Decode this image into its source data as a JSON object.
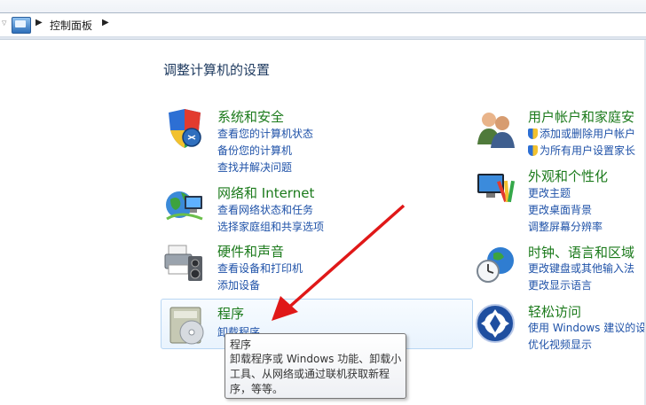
{
  "address_bar": {
    "crumb": "控制面板"
  },
  "heading": "调整计算机的设置",
  "categories_left": [
    {
      "title": "系统和安全",
      "icon": "shield-security-icon",
      "links": [
        "查看您的计算机状态",
        "备份您的计算机",
        "查找并解决问题"
      ]
    },
    {
      "title": "网络和 Internet",
      "icon": "network-globe-icon",
      "links": [
        "查看网络状态和任务",
        "选择家庭组和共享选项"
      ]
    },
    {
      "title": "硬件和声音",
      "icon": "printer-speaker-icon",
      "links": [
        "查看设备和打印机",
        "添加设备"
      ]
    },
    {
      "title": "程序",
      "icon": "programs-disc-icon",
      "links": [
        "卸载程序"
      ]
    }
  ],
  "categories_right": [
    {
      "title": "用户帐户和家庭安",
      "icon": "users-icon",
      "links": [
        "添加或删除用户帐户",
        "为所有用户设置家长"
      ]
    },
    {
      "title": "外观和个性化",
      "icon": "monitor-palette-icon",
      "links": [
        "更改主题",
        "更改桌面背景",
        "调整屏幕分辨率"
      ]
    },
    {
      "title": "时钟、语言和区域",
      "icon": "clock-globe-icon",
      "links": [
        "更改键盘或其他输入法",
        "更改显示语言"
      ]
    },
    {
      "title": "轻松访问",
      "icon": "ease-of-access-icon",
      "links": [
        "使用 Windows 建议的设",
        "优化视频显示"
      ]
    }
  ],
  "tooltip": {
    "title": "程序",
    "description": "卸载程序或 Windows 功能、卸载小工具、从网络或通过联机获取新程序，等等。"
  },
  "colors": {
    "category_title": "#1b7a1b",
    "link": "#1f52a8",
    "heading": "#1e3a5f",
    "annotation_arrow": "#e01818"
  }
}
